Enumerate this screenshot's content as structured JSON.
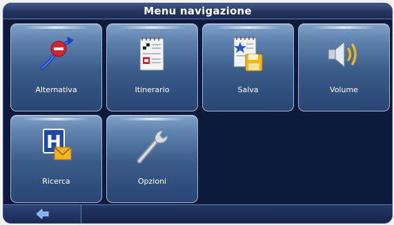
{
  "header": {
    "title": "Menu navigazione"
  },
  "menu": {
    "items": [
      {
        "label": "Alternativa",
        "icon": "detour-icon"
      },
      {
        "label": "Itinerario",
        "icon": "itinerary-icon"
      },
      {
        "label": "Salva",
        "icon": "save-icon"
      },
      {
        "label": "Volume",
        "icon": "volume-icon"
      },
      {
        "label": "Ricerca",
        "icon": "hospital-search-icon"
      },
      {
        "label": "Opzioni",
        "icon": "wrench-icon"
      }
    ]
  },
  "footer": {
    "back_icon": "back-arrow-icon"
  },
  "colors": {
    "background": "#0d1a3c",
    "tile": "#3a5a88",
    "accent_yellow": "#f2b51c",
    "accent_red": "#d6262f"
  }
}
